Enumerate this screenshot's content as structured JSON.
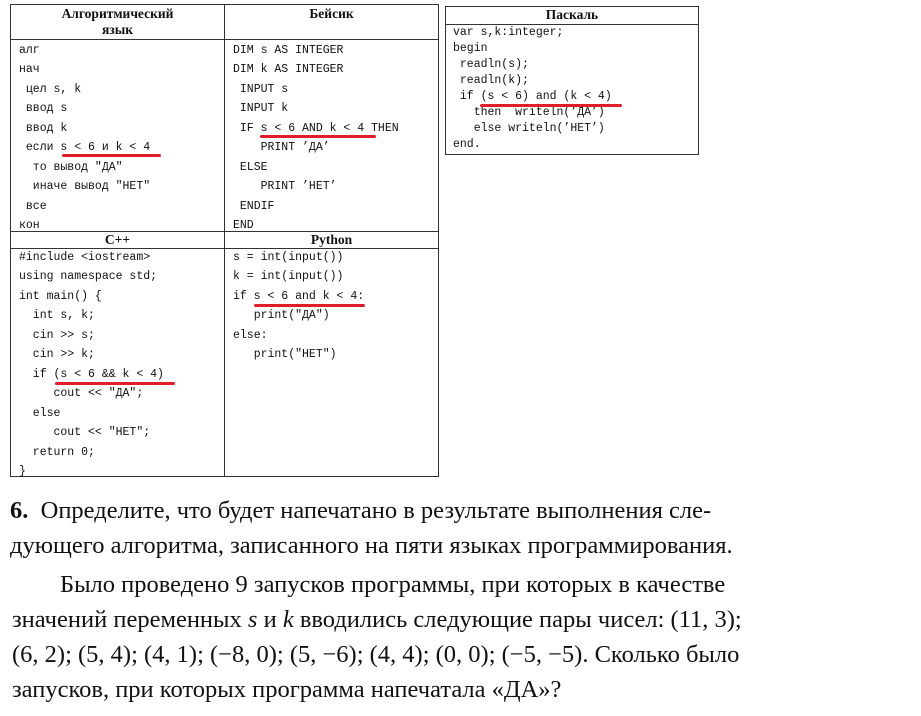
{
  "main_table": {
    "headers": {
      "algo": "Алгоритмический язык",
      "algo_line1": "Алгоритмический",
      "algo_line2": "язык",
      "basic": "Бейсик",
      "cpp": "C++",
      "python": "Python"
    },
    "algo_lines": [
      "алг",
      "нач",
      " цел s, k",
      " ввод s",
      " ввод k",
      " если s < 6 и k < 4",
      "  то вывод \"ДА\"",
      "  иначе вывод \"НЕТ\"",
      " все",
      "кон"
    ],
    "basic_lines": [
      "DIM s AS INTEGER",
      "DIM k AS INTEGER",
      " INPUT s",
      " INPUT k",
      " IF s < 6 AND k < 4 THEN",
      "    PRINT ’ДА’",
      " ELSE",
      "    PRINT ’НЕТ’",
      " ENDIF",
      "END"
    ],
    "cpp_lines": [
      "#include <iostream>",
      "using namespace std;",
      "int main() {",
      "  int s, k;",
      "  cin >> s;",
      "  cin >> k;",
      "  if (s < 6 && k < 4)",
      "     cout << \"ДА\";",
      "  else",
      "     cout << \"НЕТ\";",
      "  return 0;",
      "}"
    ],
    "python_lines": [
      "s = int(input())",
      "k = int(input())",
      "if s < 6 and k < 4:",
      "   print(\"ДА\")",
      "else:",
      "   print(\"НЕТ\")"
    ]
  },
  "pascal_table": {
    "header": "Паскаль",
    "lines": [
      "var s,k:integer;",
      "begin",
      " readln(s);",
      " readln(k);",
      " if (s < 6) and (k < 4)",
      "   then  writeln(’ДА’)",
      "   else writeln(’НЕТ’)",
      "end."
    ]
  },
  "highlight_color": "#e01e2a",
  "task": {
    "number": "6.",
    "line1": "Определите, что будет напечатано в результате выполнения сле-",
    "line2": "дующего алгоритма, записанного на пяти языках программирования.",
    "line3": "Было проведено 9 запусков программы, при которых в качестве",
    "line4_a": "значений переменных ",
    "var_s": "s",
    "line4_b": " и ",
    "var_k": "k",
    "line4_c": " вводились следующие пары чисел: (11, 3);",
    "line5": "(6, 2); (5, 4); (4, 1); (−8, 0); (5, −6); (4, 4); (0, 0); (−5, −5). Сколько было",
    "line6": "запусков, при которых программа напечатала «ДА»?",
    "pairs": [
      [
        11,
        3
      ],
      [
        6,
        2
      ],
      [
        5,
        4
      ],
      [
        4,
        1
      ],
      [
        -8,
        0
      ],
      [
        5,
        -6
      ],
      [
        4,
        4
      ],
      [
        0,
        0
      ],
      [
        -5,
        -5
      ]
    ]
  }
}
